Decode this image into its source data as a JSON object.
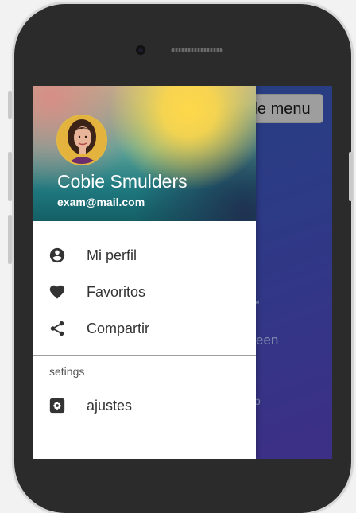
{
  "background_app": {
    "toggle_button_label": "gle menu",
    "title_fragment": "r",
    "subtitle_fragment": "een",
    "link_fragment": "o"
  },
  "drawer": {
    "header": {
      "user_name": "Cobie Smulders",
      "user_email": "exam@mail.com"
    },
    "items": [
      {
        "label": "Mi perfil",
        "icon": "account-circle-icon"
      },
      {
        "label": "Favoritos",
        "icon": "heart-icon"
      },
      {
        "label": "Compartir",
        "icon": "share-icon"
      }
    ],
    "section": {
      "title": "setings",
      "items": [
        {
          "label": "ajustes",
          "icon": "settings-icon"
        }
      ]
    }
  },
  "colors": {
    "screen_background": "#2d3a86",
    "drawer_background": "#ffffff",
    "toggle_button": "#9e9e9e",
    "icon_color": "#333333"
  }
}
